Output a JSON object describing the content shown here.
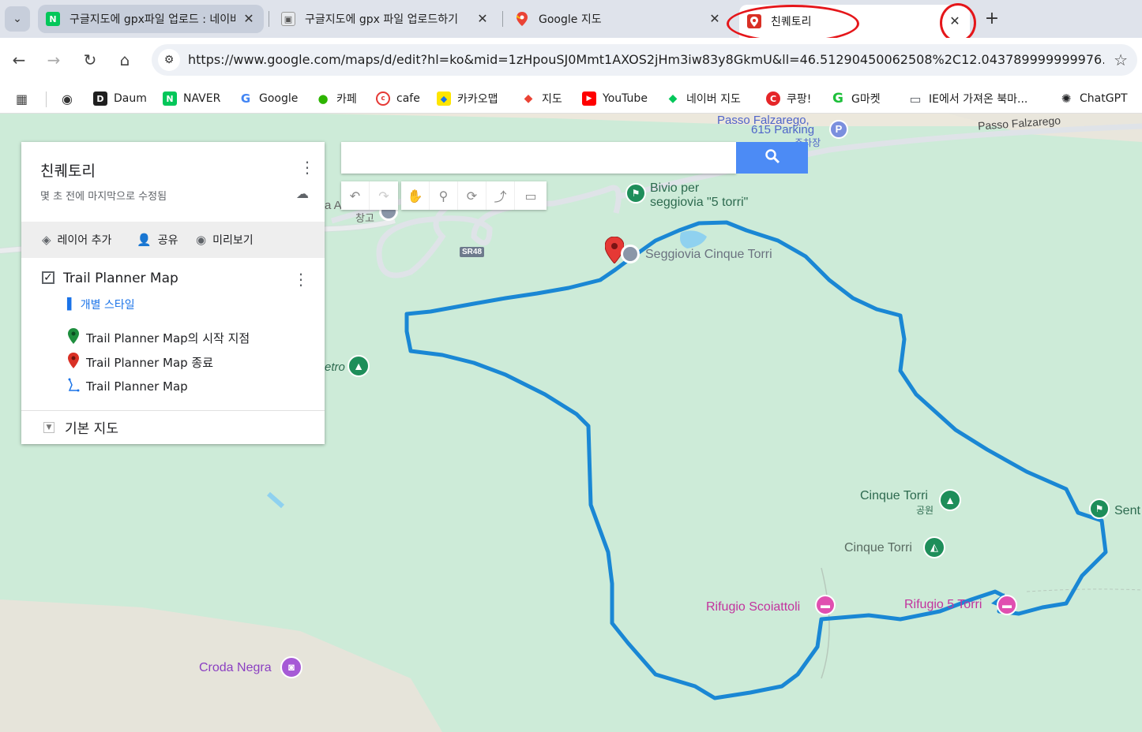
{
  "tabs": [
    {
      "title": "구글지도에 gpx파일 업로드 : 네이버 블로그",
      "favicon": "naver-icon"
    },
    {
      "title": "구글지도에 gpx 파일 업로드하기",
      "favicon": "image-icon"
    },
    {
      "title": "Google 지도",
      "favicon": "google-maps-icon"
    },
    {
      "title": "친퀘토리",
      "favicon": "my-maps-icon"
    }
  ],
  "tab_close": "✕",
  "new_tab": "+",
  "toolbar": {
    "url_host": "https://www.google.com",
    "url_path": "/maps/d/edit?hl=ko&mid=1zHpouSJ0Mmt1AXOS2jHm3iw83y8GkmU&ll=46.51290450062508%2C12.043789999999976..."
  },
  "bookmarks": [
    {
      "label": "Daum",
      "icon": "D",
      "color": "#1f1f1f"
    },
    {
      "label": "NAVER",
      "icon": "N",
      "color": "#03c75a"
    },
    {
      "label": "Google",
      "icon": "G",
      "color": "#4285f4"
    },
    {
      "label": "카페",
      "icon": "●",
      "color": "#2db400"
    },
    {
      "label": "cafe",
      "icon": "c",
      "color": "#e53935"
    },
    {
      "label": "카카오맵",
      "icon": "◆",
      "color": "#fee500"
    },
    {
      "label": "지도",
      "icon": "◆",
      "color": "#34a853"
    },
    {
      "label": "YouTube",
      "icon": "▶",
      "color": "#ff0000"
    },
    {
      "label": "네이버 지도",
      "icon": "◆",
      "color": "#03c75a"
    },
    {
      "label": "쿠팡!",
      "icon": "C",
      "color": "#e52528"
    },
    {
      "label": "G마켓",
      "icon": "G",
      "color": "#1dbf3a"
    },
    {
      "label": "IE에서 가져온 북마...",
      "icon": "▭",
      "color": "#5f6368"
    },
    {
      "label": "ChatGPT",
      "icon": "✺",
      "color": "#202124"
    }
  ],
  "panel": {
    "title": "친퀘토리",
    "subtitle": "몇 초 전에 마지막으로 수정됨",
    "actions": {
      "add_layer": "레이어 추가",
      "share": "공유",
      "preview": "미리보기"
    },
    "layer": {
      "name": "Trail Planner Map",
      "checked": "✓",
      "style_label": "개별 스타일",
      "items": [
        {
          "label": "Trail Planner Map의 시작 지점",
          "icon": "green-pin-icon",
          "color": "#1e8e3e"
        },
        {
          "label": "Trail Planner Map 종료",
          "icon": "red-pin-icon",
          "color": "#d93025"
        },
        {
          "label": "Trail Planner Map",
          "icon": "route-line-icon",
          "color": "#1a73e8"
        }
      ]
    },
    "base_map": "기본 지도"
  },
  "map": {
    "labels": {
      "passo_parking_1": "Passo Falzarego,",
      "passo_parking_2": "615 Parking",
      "parking_ko": "주차장",
      "passo_falzarego": "Passo Falzarego",
      "bivio_1": "Bivio per",
      "bivio_2": "seggiovia \"5 torri\"",
      "seggiovia": "Seggiovia Cinque Torri",
      "sr48": "SR48",
      "cinque_torri_park": "Cinque Torri",
      "park_ko": "공원",
      "cinque_torri": "Cinque Torri",
      "sent": "Sent",
      "rifugio_scoiattoli": "Rifugio Scoiattoli",
      "rifugio_5_torri": "Rifugio 5 Torri",
      "croda_negra": "Croda Negra",
      "etro": "etro",
      "a_left": "a A",
      "warehouse_ko": "창고",
      "parking_p": "P"
    },
    "route_color": "#1a87d4"
  }
}
